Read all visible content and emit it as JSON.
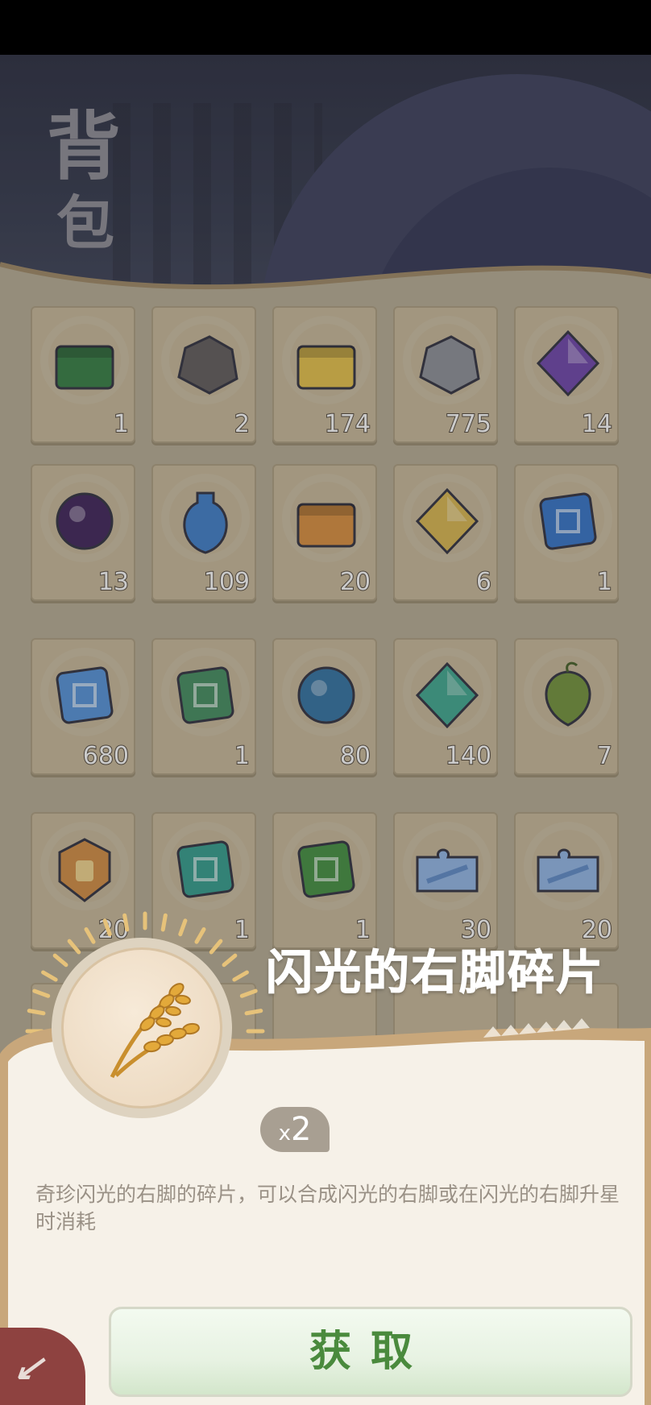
{
  "header": {
    "title_line1": "背",
    "title_line2": "包"
  },
  "items": [
    {
      "count": "1",
      "icon": "treasure-chest-icon",
      "color": "#2f7a3e"
    },
    {
      "count": "2",
      "icon": "ore-sack-icon",
      "color": "#5c5656"
    },
    {
      "count": "174",
      "icon": "gold-cake-icon",
      "color": "#e5c044"
    },
    {
      "count": "775",
      "icon": "stone-icon",
      "color": "#8a8c95"
    },
    {
      "count": "14",
      "icon": "purple-crystal-icon",
      "color": "#6a3fa8"
    },
    {
      "count": "13",
      "icon": "dark-orb-icon",
      "color": "#3a1c55"
    },
    {
      "count": "109",
      "icon": "blue-potion-icon",
      "color": "#3a7ac8"
    },
    {
      "count": "20",
      "icon": "amber-box-icon",
      "color": "#d98b38"
    },
    {
      "count": "6",
      "icon": "yellow-crystal-icon",
      "color": "#d8b54a"
    },
    {
      "count": "1",
      "icon": "skill-stone-blue-icon",
      "color": "#2f6fc7"
    },
    {
      "count": "680",
      "icon": "blue-rune-icon",
      "color": "#4f8fd8"
    },
    {
      "count": "1",
      "icon": "green-rune-icon",
      "color": "#3d8a5a"
    },
    {
      "count": "80",
      "icon": "blue-sphere-icon",
      "color": "#2c6ea0"
    },
    {
      "count": "140",
      "icon": "teal-crystal-icon",
      "color": "#3aa58c"
    },
    {
      "count": "7",
      "icon": "green-fruit-icon",
      "color": "#6e8f35"
    },
    {
      "count": "20",
      "icon": "amber-badge-icon",
      "color": "#d28a3e"
    },
    {
      "count": "1",
      "icon": "skill-stone-teal-icon",
      "color": "#2d9a8a"
    },
    {
      "count": "1",
      "icon": "skill-stone-green-icon",
      "color": "#3e8c3b"
    },
    {
      "count": "30",
      "icon": "puzzle-blue-icon",
      "color": "#5a88c8"
    },
    {
      "count": "20",
      "icon": "puzzle-pink-icon",
      "color": "#5a88c8"
    }
  ],
  "detail": {
    "name": "闪光的右脚碎片",
    "quantity_prefix": "x",
    "quantity": "2",
    "description": "奇珍闪光的右脚的碎片，可以合成闪光的右脚或在闪光的右脚升星时消耗",
    "icon": "wheat-icon",
    "get_button_label": "获取"
  },
  "colors": {
    "accent_green": "#4a8a3d",
    "panel": "#f6f1e8",
    "panel_edge": "#c8a77b"
  }
}
